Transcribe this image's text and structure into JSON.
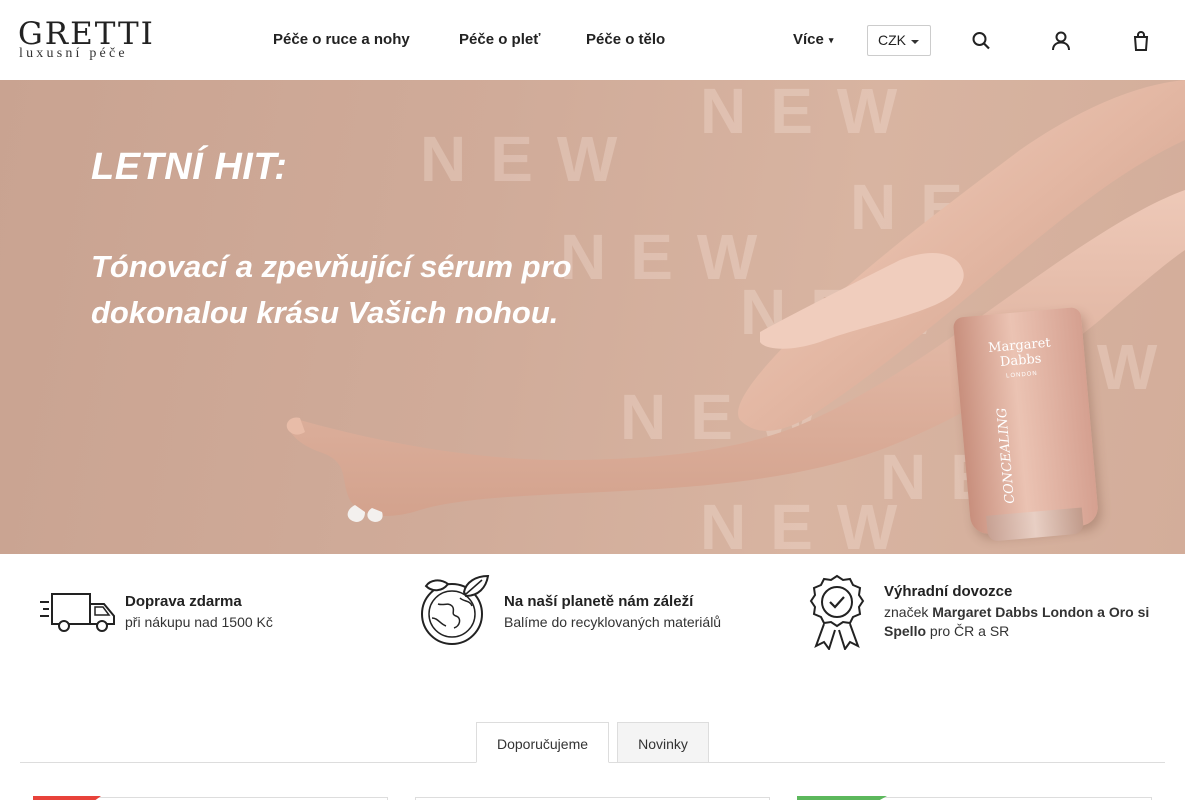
{
  "header": {
    "logo": {
      "name": "GRETTI",
      "tagline": "luxusní péče"
    },
    "nav": [
      {
        "label": "Péče o ruce a nohy"
      },
      {
        "label": "Péče o pleť"
      },
      {
        "label": "Péče o tělo"
      }
    ],
    "more_label": "Více",
    "currency": {
      "selected": "CZK"
    },
    "icons": [
      "search-icon",
      "user-icon",
      "cart-icon"
    ]
  },
  "hero": {
    "watermark": "NEW",
    "title": "LETNÍ HIT:",
    "subtitle": "Tónovací a zpevňující sérum pro dokonalou krásu Vašich nohou.",
    "product": {
      "brand": "Margaret Dabbs",
      "brand_sub": "LONDON",
      "name": "CONCEALING"
    }
  },
  "benefits": [
    {
      "icon": "delivery-truck-icon",
      "title": "Doprava zdarma",
      "text": "při nákupu nad 1500 Kč"
    },
    {
      "icon": "planet-leaf-icon",
      "title": "Na naší planetě nám záleží",
      "text": "Balíme do recyklovaných materiálů"
    },
    {
      "icon": "award-badge-icon",
      "title": "Výhradní dovozce",
      "text_prefix": "značek ",
      "text_strong": "Margaret Dabbs London a Oro si Spello",
      "text_suffix": " pro ČR a SR"
    }
  ],
  "tabs": [
    {
      "label": "Doporučujeme",
      "active": true
    },
    {
      "label": "Novinky",
      "active": false
    }
  ],
  "colors": {
    "accent_red": "#e8423a",
    "accent_green": "#5cb85c",
    "hero_bg": "#d0ab99"
  }
}
